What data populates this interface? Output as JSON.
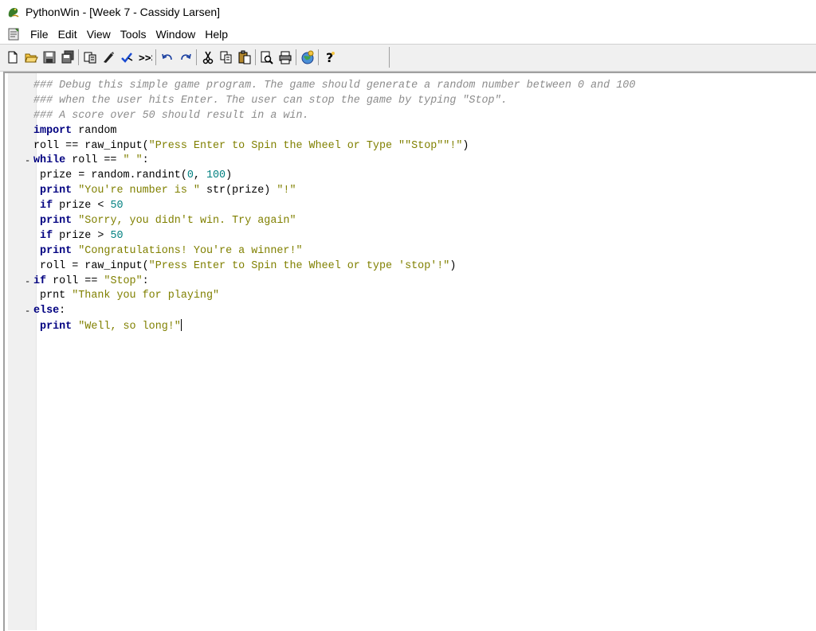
{
  "window": {
    "title": "PythonWin - [Week 7 - Cassidy Larsen]"
  },
  "menu": {
    "items": [
      "File",
      "Edit",
      "View",
      "Tools",
      "Window",
      "Help"
    ]
  },
  "toolbar": {
    "buttons": [
      {
        "icon": "new-document-icon"
      },
      {
        "icon": "open-folder-icon"
      },
      {
        "icon": "save-icon"
      },
      {
        "icon": "save-all-icon"
      },
      {
        "sep": true
      },
      {
        "icon": "import-module-icon"
      },
      {
        "icon": "check-module-icon"
      },
      {
        "icon": "run-icon"
      },
      {
        "icon": "interactive-window-icon"
      },
      {
        "sep": true
      },
      {
        "icon": "undo-icon"
      },
      {
        "icon": "redo-icon"
      },
      {
        "sep": true
      },
      {
        "icon": "cut-icon"
      },
      {
        "icon": "copy-icon"
      },
      {
        "icon": "paste-icon"
      },
      {
        "sep": true
      },
      {
        "icon": "print-preview-icon"
      },
      {
        "icon": "print-icon"
      },
      {
        "sep": true
      },
      {
        "icon": "browser-icon"
      },
      {
        "sep": true
      },
      {
        "icon": "help-icon"
      }
    ]
  },
  "editor": {
    "lines": [
      {
        "fold": "",
        "tokens": [
          [
            "cmt",
            "### Debug this simple game program. The game should generate a random number between 0 and 100"
          ]
        ]
      },
      {
        "fold": "",
        "tokens": [
          [
            "cmt",
            "### when the user hits Enter. The user can stop the game by typing \"Stop\"."
          ]
        ]
      },
      {
        "fold": "",
        "tokens": [
          [
            "cmt",
            "### A score over 50 should result in a win."
          ]
        ]
      },
      {
        "fold": "",
        "tokens": [
          [
            "kw",
            "import"
          ],
          [
            "plain",
            " random"
          ]
        ]
      },
      {
        "fold": "",
        "tokens": [
          [
            "plain",
            "roll == raw_input("
          ],
          [
            "str",
            "\"Press Enter to Spin the Wheel or Type \"\"Stop\"\"!\""
          ],
          [
            "plain",
            ")"
          ]
        ]
      },
      {
        "fold": "-",
        "tokens": [
          [
            "kw",
            "while"
          ],
          [
            "plain",
            " roll == "
          ],
          [
            "str",
            "\" \""
          ],
          [
            "plain",
            ":"
          ]
        ]
      },
      {
        "fold": "",
        "tokens": [
          [
            "plain",
            " prize = random.randint("
          ],
          [
            "num",
            "0"
          ],
          [
            "plain",
            ", "
          ],
          [
            "num",
            "100"
          ],
          [
            "plain",
            ")"
          ]
        ]
      },
      {
        "fold": "",
        "tokens": [
          [
            "kw",
            " print"
          ],
          [
            "plain",
            " "
          ],
          [
            "str",
            "\"You're number is \""
          ],
          [
            "plain",
            " str(prize) "
          ],
          [
            "str",
            "\"!\""
          ]
        ]
      },
      {
        "fold": "",
        "tokens": [
          [
            "kw",
            " if"
          ],
          [
            "plain",
            " prize < "
          ],
          [
            "num",
            "50"
          ]
        ]
      },
      {
        "fold": "",
        "tokens": [
          [
            "kw",
            " print"
          ],
          [
            "plain",
            " "
          ],
          [
            "str",
            "\"Sorry, you didn't win. Try again\""
          ]
        ]
      },
      {
        "fold": "",
        "tokens": [
          [
            "kw",
            " if"
          ],
          [
            "plain",
            " prize > "
          ],
          [
            "num",
            "50"
          ]
        ]
      },
      {
        "fold": "",
        "tokens": [
          [
            "kw",
            " print"
          ],
          [
            "plain",
            " "
          ],
          [
            "str",
            "\"Congratulations! You're a winner!\""
          ]
        ]
      },
      {
        "fold": "",
        "tokens": [
          [
            "plain",
            " roll = raw_input("
          ],
          [
            "str",
            "\"Press Enter to Spin the Wheel or type 'stop'!\""
          ],
          [
            "plain",
            ")"
          ]
        ]
      },
      {
        "fold": "-",
        "tokens": [
          [
            "kw",
            "if"
          ],
          [
            "plain",
            " roll == "
          ],
          [
            "str",
            "\"Stop\""
          ],
          [
            "plain",
            ":"
          ]
        ]
      },
      {
        "fold": "",
        "tokens": [
          [
            "plain",
            " prnt "
          ],
          [
            "str",
            "\"Thank you for playing\""
          ]
        ]
      },
      {
        "fold": "-",
        "tokens": [
          [
            "kw",
            "else"
          ],
          [
            "plain",
            ":"
          ]
        ]
      },
      {
        "fold": "",
        "tokens": [
          [
            "kw",
            " print"
          ],
          [
            "plain",
            " "
          ],
          [
            "str",
            "\"Well, so long!\""
          ]
        ],
        "caret": true
      }
    ]
  }
}
